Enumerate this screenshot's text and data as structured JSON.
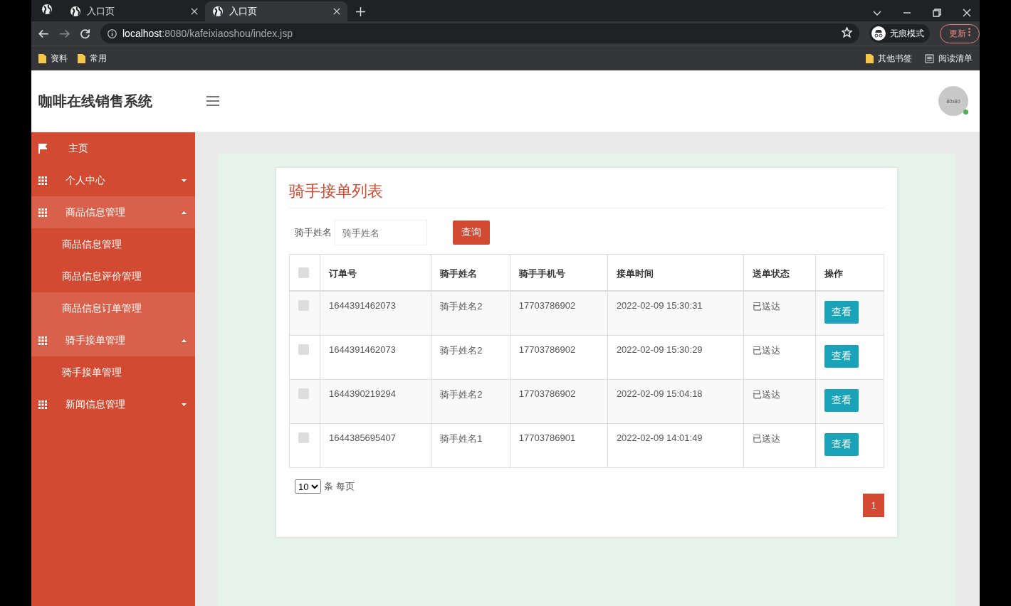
{
  "browser": {
    "tabs": [
      {
        "title": "入口页",
        "selected": false
      },
      {
        "title": "入口页",
        "selected": true
      }
    ],
    "url_host": "localhost",
    "url_path": ":8080/kafeixiaoshou/index.jsp",
    "incognito_label": "无痕模式",
    "update_label": "更新",
    "bookmarks": [
      "资料",
      "常用"
    ],
    "other_bookmarks": "其他书签",
    "reading_list": "阅读清单"
  },
  "header": {
    "title": "咖啡在线销售系统",
    "avatar_text": "80x80",
    "online": true
  },
  "sidebar": {
    "items": [
      {
        "kind": "link",
        "label": "主页",
        "selected": false
      },
      {
        "kind": "group",
        "label": "个人中心",
        "expanded": false
      },
      {
        "kind": "group",
        "label": "商品信息管理",
        "expanded": true,
        "children": [
          {
            "label": "商品信息管理",
            "selected": false
          },
          {
            "label": "商品信息评价管理",
            "selected": false
          },
          {
            "label": "商品信息订单管理",
            "selected": true
          }
        ]
      },
      {
        "kind": "group",
        "label": "骑手接单管理",
        "expanded": true,
        "children": [
          {
            "label": "骑手接单管理",
            "selected": false
          }
        ]
      },
      {
        "kind": "group",
        "label": "新闻信息管理",
        "expanded": false
      }
    ]
  },
  "panel": {
    "title": "骑手接单列表",
    "search": {
      "label": "骑手姓名",
      "placeholder": "骑手姓名",
      "button": "查询"
    },
    "table": {
      "columns": [
        "订单号",
        "骑手姓名",
        "骑手手机号",
        "接单时间",
        "送单状态",
        "操作"
      ],
      "all_checked": false,
      "rows": [
        {
          "checked": false,
          "cells": [
            "1644391462073",
            "骑手姓名2",
            "17703786902",
            "2022-02-09 15:30:31",
            "已送达"
          ],
          "action": "查看"
        },
        {
          "checked": false,
          "cells": [
            "1644391462073",
            "骑手姓名2",
            "17703786902",
            "2022-02-09 15:30:29",
            "已送达"
          ],
          "action": "查看"
        },
        {
          "checked": false,
          "cells": [
            "1644390219294",
            "骑手姓名2",
            "17703786902",
            "2022-02-09 15:04:18",
            "已送达"
          ],
          "action": "查看"
        },
        {
          "checked": false,
          "cells": [
            "1644385695407",
            "骑手姓名1",
            "17703786901",
            "2022-02-09 14:01:49",
            "已送达"
          ],
          "action": "查看"
        }
      ]
    },
    "page_size": "10",
    "page_size_suffix": "条 每页",
    "pages": [
      {
        "label": "1",
        "selected": true
      }
    ]
  }
}
